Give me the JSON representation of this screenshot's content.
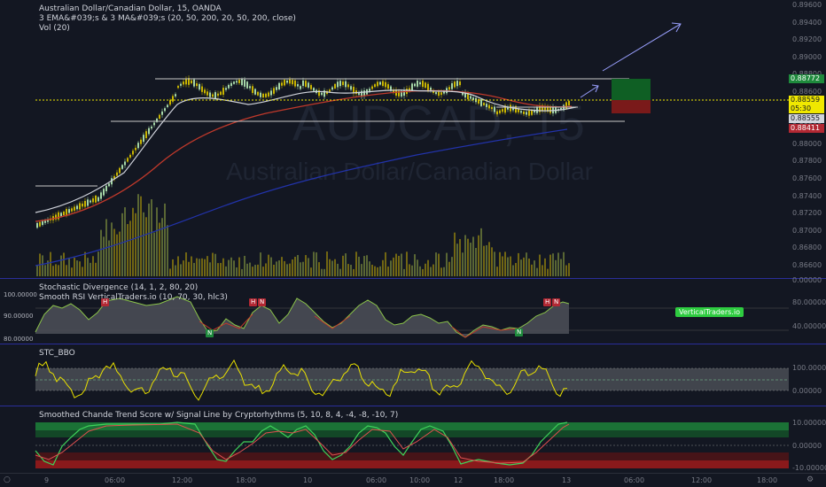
{
  "header": {
    "symbol_line": "Australian Dollar/Canadian Dollar, 15, OANDA",
    "indicator_1": "3 EMA&#039;s & 3 MA&#039;s (20, 50, 200, 20, 50, 200, close)",
    "indicator_2": "Vol (20)"
  },
  "watermark": {
    "ticker": "AUDCAD, 15",
    "name": "Australian Dollar/Canadian Dollar"
  },
  "main_axis": {
    "ticks": [
      "0.89600",
      "0.89400",
      "0.89200",
      "0.89000",
      "0.88800",
      "0.88600",
      "0.88400",
      "0.88200",
      "0.88000",
      "0.87800",
      "0.87600",
      "0.87400",
      "0.87200",
      "0.87000",
      "0.86800",
      "0.86600"
    ],
    "price_labels": [
      {
        "text": "0.88772",
        "bg": "#1e8a3c",
        "fg": "#ffffff"
      },
      {
        "text": "0.88559",
        "bg": "#f0e800",
        "fg": "#131722"
      },
      {
        "text": "05:30",
        "bg": "#f0e800",
        "fg": "#131722"
      },
      {
        "text": "0.88555",
        "bg": "#d1d4dc",
        "fg": "#131722"
      },
      {
        "text": "0.88411",
        "bg": "#b22833",
        "fg": "#ffffff"
      }
    ]
  },
  "stoch_pane": {
    "title_1": "Stochastic Divergence (14, 1, 2, 80, 20)",
    "title_2": "Smooth RSI VerticalTraders.io (10, 70, 30, hlc3)",
    "left_ticks": [
      "100.00000",
      "90.00000",
      "80.00000"
    ],
    "right_ticks": [
      "80.00000",
      "40.00000",
      "0.00000"
    ],
    "badges": [
      {
        "text": "H",
        "kind": "hn"
      },
      {
        "text": "H",
        "kind": "hn"
      },
      {
        "text": "N",
        "kind": "hn"
      },
      {
        "text": "N",
        "kind": "ng"
      },
      {
        "text": "N",
        "kind": "ng"
      },
      {
        "text": "H",
        "kind": "hn"
      },
      {
        "text": "N",
        "kind": "hn"
      }
    ],
    "brand_label": "VerticalTraders.io"
  },
  "stc_pane": {
    "title": "STC_BBO",
    "right_ticks": [
      "100.00000",
      "0.00000"
    ]
  },
  "chande_pane": {
    "title": "Smoothed Chande Trend Score w/ Signal Line by Cryptorhythms (5, 10, 8, 4, -4, -8, -10, 7)",
    "right_ticks": [
      "10.00000",
      "0.00000",
      "-10.00000"
    ]
  },
  "time_axis": {
    "labels": [
      "9",
      "06:00",
      "12:00",
      "18:00",
      "10",
      "06:00",
      "10:00",
      "12",
      "18:00",
      "13",
      "06:00",
      "12:00",
      "18:00"
    ]
  },
  "colors": {
    "background": "#131722",
    "up_candle": "#a5d6a7",
    "down_candle": "#c8b400",
    "ema_fast": "#d1d4dc",
    "ema_mid": "#c0392b",
    "ma_slow": "#2233aa",
    "current_price": "#f0e800"
  }
}
